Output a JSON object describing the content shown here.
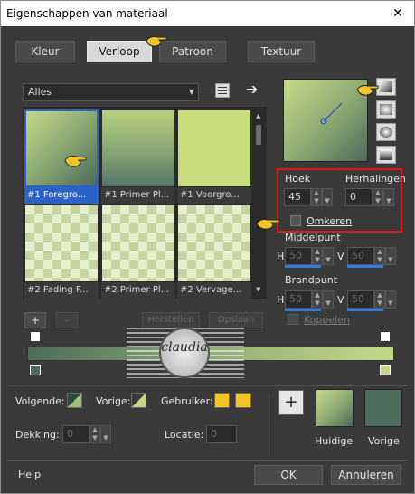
{
  "window": {
    "title": "Eigenschappen van materiaal"
  },
  "tabs": [
    {
      "label": "Kleur"
    },
    {
      "label": "Verloop"
    },
    {
      "label": "Patroon"
    },
    {
      "label": "Textuur"
    }
  ],
  "library": {
    "category": "Alles",
    "thumbnails": [
      {
        "label": "#1 Foregro..."
      },
      {
        "label": "#1 Primer Pl..."
      },
      {
        "label": "#1 Voorgro..."
      },
      {
        "label": "#2 Fading F..."
      },
      {
        "label": "#2 Primer Pl..."
      },
      {
        "label": "#2 Vervage..."
      }
    ],
    "add_label": "+",
    "remove_label": "-",
    "restore_label": "Herstellen",
    "save_label": "Opslaan"
  },
  "settings": {
    "angle_label": "Hoek",
    "angle_value": "45",
    "repeats_label": "Herhalingen",
    "repeats_value": "0",
    "invert_label": "Omkeren",
    "midpoint_label": "Middelpunt",
    "mid_h_label": "H",
    "mid_h_value": "50",
    "mid_v_label": "V",
    "mid_v_value": "50",
    "focal_label": "Brandpunt",
    "focal_h_label": "H",
    "focal_h_value": "50",
    "focal_v_label": "V",
    "focal_v_value": "50",
    "link_label": "Koppelen"
  },
  "bottom": {
    "following_label": "Volgende:",
    "previous_label": "Vorige:",
    "user_label": "Gebruiker:",
    "opacity_label": "Dekking:",
    "opacity_value": "0",
    "location_label": "Locatie:",
    "location_value": "0",
    "plus_label": "+",
    "current_label": "Huidige",
    "previous_swatch_label": "Vorige"
  },
  "watermark": {
    "text": "claudia"
  },
  "footer": {
    "help_label": "Help",
    "ok_label": "OK",
    "cancel_label": "Annuleren"
  },
  "colors": {
    "gradient_light": "#c5d888",
    "gradient_dark": "#4c6b5b",
    "user_color": "#f2c525",
    "highlight_red": "#e01818",
    "selection_blue": "#2a62c9"
  }
}
